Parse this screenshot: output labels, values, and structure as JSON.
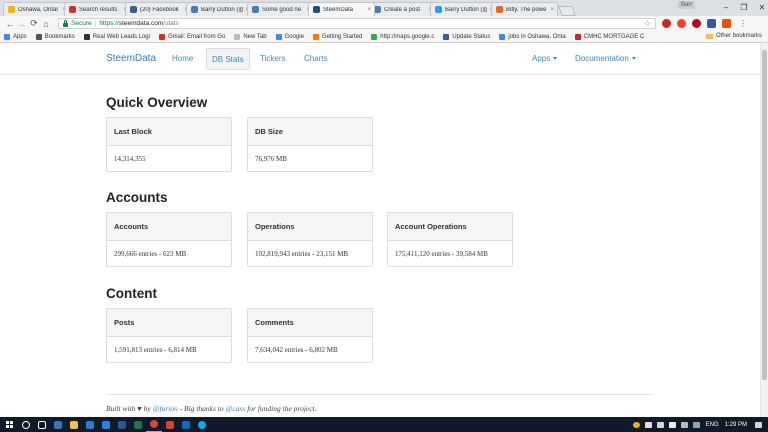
{
  "browser": {
    "tabs": [
      {
        "label": "Oshawa, Ontar",
        "color": "#f4b400",
        "active": false
      },
      {
        "label": "Search results",
        "color": "#d93025",
        "active": false
      },
      {
        "label": "(20) Facebook",
        "color": "#3b5998",
        "active": false
      },
      {
        "label": "Barry Dutton (@",
        "color": "#4a7cb8",
        "active": false
      },
      {
        "label": "Some good ne",
        "color": "#4a7cb8",
        "active": false
      },
      {
        "label": "SteemData",
        "color": "#1a4f8c",
        "active": true
      },
      {
        "label": "Create a post",
        "color": "#4a7cb8",
        "active": false
      },
      {
        "label": "Barry Dutton (@",
        "color": "#1da1f2",
        "active": false
      },
      {
        "label": "Bitly. The powe",
        "color": "#ee6123",
        "active": false
      }
    ],
    "profile_label": "Barr",
    "address": {
      "secure_label": "Secure",
      "scheme": "https://",
      "host": "steemdata.com",
      "path": "/stats"
    },
    "bookmarks": [
      {
        "label": "Apps",
        "color": "#4285f4"
      },
      {
        "label": "Bookmarks",
        "color": "#555555"
      },
      {
        "label": "Real Web Leads Logi",
        "color": "#333333"
      },
      {
        "label": "Gmail: Email from Go",
        "color": "#d93025"
      },
      {
        "label": "New Tab",
        "color": "#bbbbbb"
      },
      {
        "label": "Google",
        "color": "#4285f4"
      },
      {
        "label": "Getting Started",
        "color": "#f57c00"
      },
      {
        "label": "http://maps.google.c",
        "color": "#34a853"
      },
      {
        "label": "Update Status",
        "color": "#3b5998"
      },
      {
        "label": "jobs in Oshawa, Onta",
        "color": "#4285f4"
      },
      {
        "label": "CMHC MORTGAGE C",
        "color": "#c62828"
      }
    ],
    "other_bookmarks": "Other bookmarks"
  },
  "site": {
    "brand": "SteemData",
    "nav": {
      "home": "Home",
      "db_stats": "DB Stats",
      "tickers": "Tickers",
      "charts": "Charts",
      "apps": "Apps",
      "documentation": "Documentation"
    }
  },
  "sections": {
    "quick_overview": {
      "title": "Quick Overview",
      "last_block": {
        "label": "Last Block",
        "value": "14,314,355"
      },
      "db_size": {
        "label": "DB Size",
        "value": "76,976 MB"
      }
    },
    "accounts": {
      "title": "Accounts",
      "accounts": {
        "label": "Accounts",
        "value": "299,666 entries - 623 MB"
      },
      "operations": {
        "label": "Operations",
        "value": "102,819,943 entries - 23,151 MB"
      },
      "account_operations": {
        "label": "Account Operations",
        "value": "175,411,120 entries - 39,584 MB"
      }
    },
    "content": {
      "title": "Content",
      "posts": {
        "label": "Posts",
        "value": "1,591,813 entries - 6,814 MB"
      },
      "comments": {
        "label": "Comments",
        "value": "7,634,042 entries - 6,802 MB"
      }
    }
  },
  "footer": {
    "built_with": "Built with",
    "heart": "♥",
    "by": "by",
    "author": "@furion",
    "thanks": "- Big thanks to",
    "sponsor": "@cass",
    "funding": "for funding the project."
  },
  "taskbar": {
    "lang": "ENG",
    "time": "1:29 PM"
  }
}
